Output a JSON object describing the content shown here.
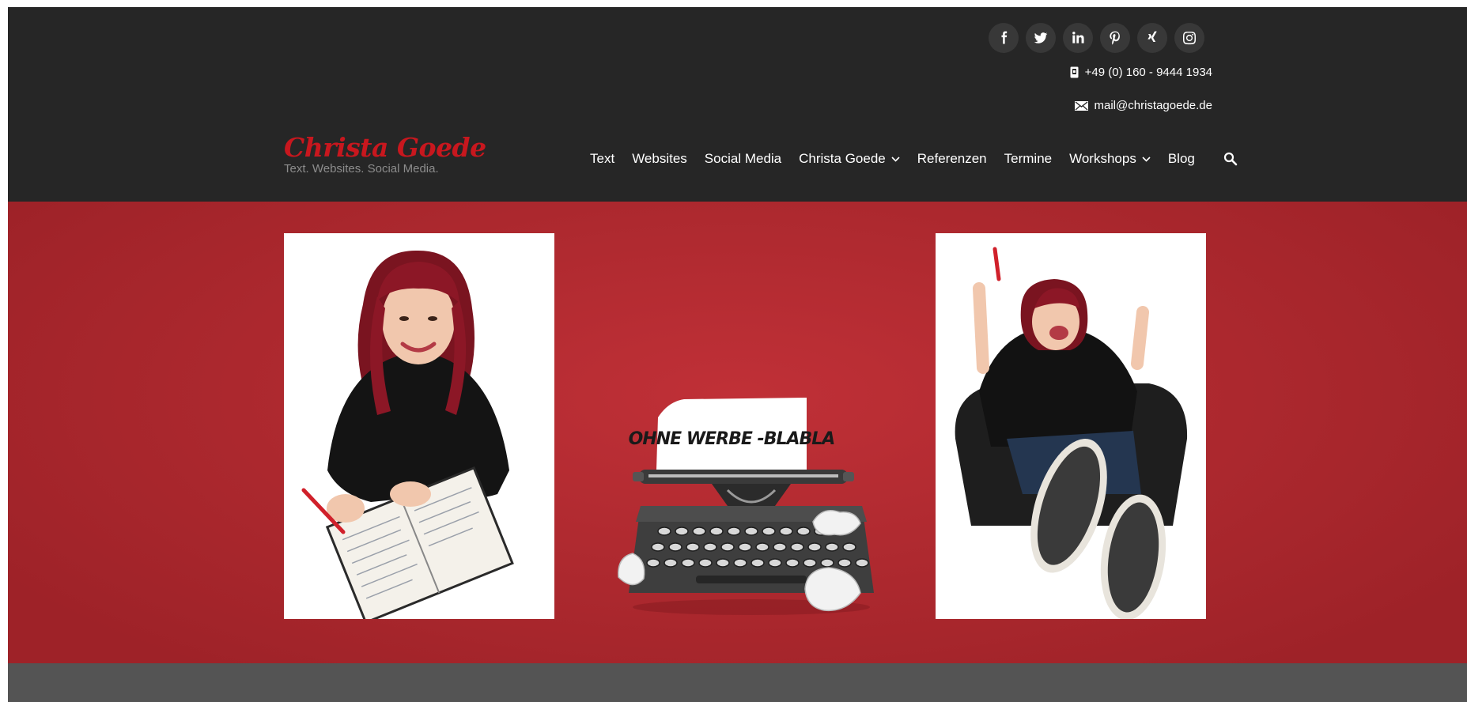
{
  "header": {
    "social": [
      {
        "name": "facebook-icon"
      },
      {
        "name": "twitter-icon"
      },
      {
        "name": "linkedin-icon"
      },
      {
        "name": "pinterest-icon"
      },
      {
        "name": "xing-icon"
      },
      {
        "name": "instagram-icon"
      }
    ],
    "phone": "+49 (0) 160 - 9444 1934",
    "email": "mail@christagoede.de"
  },
  "logo": {
    "title": "Christa Goede",
    "tagline": "Text. Websites. Social Media."
  },
  "nav": {
    "items": [
      {
        "label": "Text",
        "dropdown": false
      },
      {
        "label": "Websites",
        "dropdown": false
      },
      {
        "label": "Social Media",
        "dropdown": false
      },
      {
        "label": "Christa Goede",
        "dropdown": true
      },
      {
        "label": "Referenzen",
        "dropdown": false
      },
      {
        "label": "Termine",
        "dropdown": false
      },
      {
        "label": "Workshops",
        "dropdown": true
      },
      {
        "label": "Blog",
        "dropdown": false
      }
    ],
    "search_icon": "search-icon"
  },
  "hero": {
    "typewriter_paper_text": "OHNE WERBE -BLABLA"
  },
  "colors": {
    "header_bg": "#262626",
    "brand_red": "#c8171e",
    "hero_red": "#b02a30",
    "footer_band": "#545454"
  }
}
